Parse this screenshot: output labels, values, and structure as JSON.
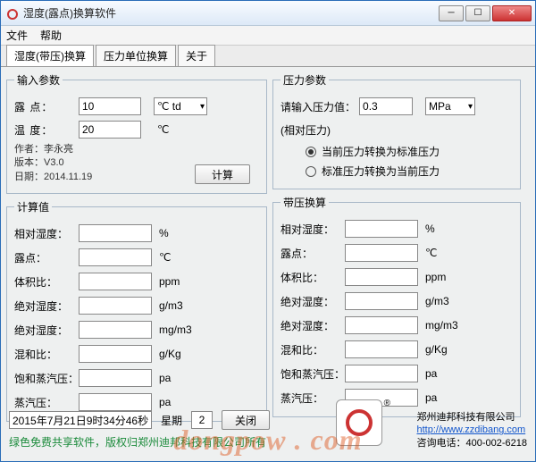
{
  "title": "湿度(露点)换算软件",
  "menu": {
    "file": "文件",
    "help": "帮助"
  },
  "tabs": {
    "t1": "湿度(带压)换算",
    "t2": "压力单位换算",
    "t3": "关于"
  },
  "input_params": {
    "legend": "输入参数",
    "dew_label": "露  点：",
    "dew_val": "10",
    "dew_unit": "℃ td",
    "temp_label": "温  度：",
    "temp_val": "20",
    "temp_unit": "℃",
    "author_l": "作者：",
    "author": "李永亮",
    "ver_l": "版本：",
    "ver": "V3.0",
    "date_l": "日期：",
    "date": "2014.11.19",
    "calc_btn": "计算"
  },
  "pressure_params": {
    "legend": "压力参数",
    "prompt": "请输入压力值：",
    "val": "0.3",
    "unit": "MPa",
    "note": "(相对压力)",
    "r1": "当前压力转换为标准压力",
    "r2": "标准压力转换为当前压力"
  },
  "calc": {
    "legend": "计算值",
    "rows": [
      {
        "l": "相对湿度：",
        "u": "%"
      },
      {
        "l": "露点：",
        "u": "℃"
      },
      {
        "l": "体积比：",
        "u": "ppm"
      },
      {
        "l": "绝对湿度：",
        "u": "g/m3"
      },
      {
        "l": "绝对湿度：",
        "u": "mg/m3"
      },
      {
        "l": "混和比：",
        "u": "g/Kg"
      },
      {
        "l": "饱和蒸汽压：",
        "u": "pa"
      },
      {
        "l": "蒸汽压：",
        "u": "pa"
      }
    ]
  },
  "presscalc": {
    "legend": "带压换算",
    "rows": [
      {
        "l": "相对湿度：",
        "u": "%"
      },
      {
        "l": "露点：",
        "u": "℃"
      },
      {
        "l": "体积比：",
        "u": "ppm"
      },
      {
        "l": "绝对湿度：",
        "u": "g/m3"
      },
      {
        "l": "绝对湿度：",
        "u": "mg/m3"
      },
      {
        "l": "混和比：",
        "u": "g/Kg"
      },
      {
        "l": "饱和蒸汽压：",
        "u": "pa"
      },
      {
        "l": "蒸汽压：",
        "u": "pa"
      }
    ]
  },
  "footer": {
    "datetime": "2015年7月21日9时34分46秒",
    "week_l": "星期",
    "week_v": "2",
    "close": "关闭"
  },
  "green": "绿色免费共享软件，版权归郑州迪邦科技有限公司所有",
  "company": {
    "name": "郑州迪邦科技有限公司",
    "url": "http://www.zzdibang.com",
    "tel_l": "咨询电话：",
    "tel": "400-002-6218"
  },
  "watermark": "dongpow . com"
}
